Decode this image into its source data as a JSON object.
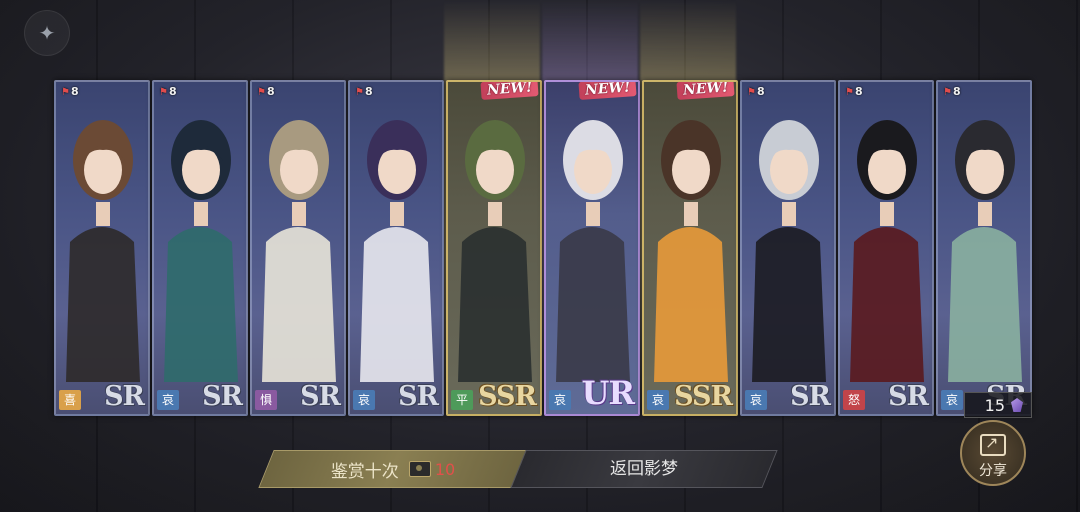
{
  "colors": {
    "mood": {
      "喜": "#d9a04a",
      "哀": "#4a78b0",
      "惧": "#8a5aa0",
      "平": "#4e9a5a",
      "怒": "#c2444a"
    },
    "beam_ssr": "#f3dd84",
    "beam_ur": "#b89be8",
    "accent_gold": "#8a7f52",
    "cost_red": "#e0504a"
  },
  "cards": [
    {
      "level": "8",
      "mood": "喜",
      "rarity": "SR",
      "is_new": false,
      "new_label": "",
      "tier": "sr",
      "hair": "#6b4a35",
      "outfit": "#2d2a2a"
    },
    {
      "level": "8",
      "mood": "哀",
      "rarity": "SR",
      "is_new": false,
      "new_label": "",
      "tier": "sr",
      "hair": "#1e2a3a",
      "outfit": "#2f6b6b"
    },
    {
      "level": "8",
      "mood": "惧",
      "rarity": "SR",
      "is_new": false,
      "new_label": "",
      "tier": "sr",
      "hair": "#a89a80",
      "outfit": "#e8e4d8"
    },
    {
      "level": "8",
      "mood": "哀",
      "rarity": "SR",
      "is_new": false,
      "new_label": "",
      "tier": "sr",
      "hair": "#3a2f5a",
      "outfit": "#e8e8ee"
    },
    {
      "level": "",
      "mood": "平",
      "rarity": "SSR",
      "is_new": true,
      "new_label": "NEW!",
      "tier": "ssr",
      "hair": "#5a6b40",
      "outfit": "#2a3030"
    },
    {
      "level": "",
      "mood": "哀",
      "rarity": "UR",
      "is_new": true,
      "new_label": "NEW!",
      "tier": "ur",
      "hair": "#dcdce4",
      "outfit": "#3a3a48"
    },
    {
      "level": "",
      "mood": "哀",
      "rarity": "SSR",
      "is_new": true,
      "new_label": "NEW!",
      "tier": "ssr",
      "hair": "#4a3428",
      "outfit": "#e89a3a"
    },
    {
      "level": "8",
      "mood": "哀",
      "rarity": "SR",
      "is_new": false,
      "new_label": "",
      "tier": "sr",
      "hair": "#c8ccd4",
      "outfit": "#1c1c22"
    },
    {
      "level": "8",
      "mood": "怒",
      "rarity": "SR",
      "is_new": false,
      "new_label": "",
      "tier": "sr",
      "hair": "#1a1a1e",
      "outfit": "#5a1a1e"
    },
    {
      "level": "8",
      "mood": "哀",
      "rarity": "SR",
      "is_new": false,
      "new_label": "",
      "tier": "sr",
      "hair": "#2a2a30",
      "outfit": "#8ab0a0"
    }
  ],
  "buttons": {
    "appraise_label": "鉴赏十次",
    "appraise_cost": "10",
    "return_label": "返回影梦"
  },
  "currency": {
    "value": "15"
  },
  "share": {
    "label": "分享"
  }
}
